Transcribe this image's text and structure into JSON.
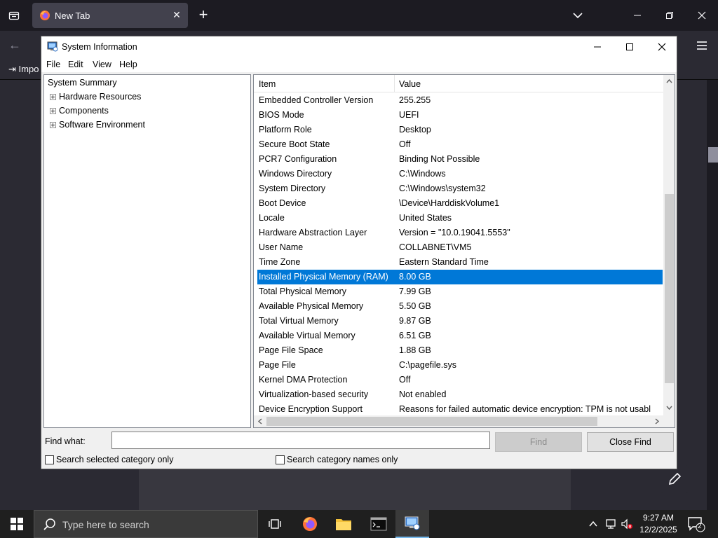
{
  "browser": {
    "tab_title": "New Tab",
    "import_label": "Impo"
  },
  "window": {
    "title": "System Information",
    "menu": [
      "File",
      "Edit",
      "View",
      "Help"
    ]
  },
  "tree": {
    "root": "System Summary",
    "children": [
      "Hardware Resources",
      "Components",
      "Software Environment"
    ]
  },
  "list": {
    "headers": {
      "item": "Item",
      "value": "Value"
    },
    "rows": [
      {
        "item": "Embedded Controller Version",
        "value": "255.255"
      },
      {
        "item": "BIOS Mode",
        "value": "UEFI"
      },
      {
        "item": "Platform Role",
        "value": "Desktop"
      },
      {
        "item": "Secure Boot State",
        "value": "Off"
      },
      {
        "item": "PCR7 Configuration",
        "value": "Binding Not Possible"
      },
      {
        "item": "Windows Directory",
        "value": "C:\\Windows"
      },
      {
        "item": "System Directory",
        "value": "C:\\Windows\\system32"
      },
      {
        "item": "Boot Device",
        "value": "\\Device\\HarddiskVolume1"
      },
      {
        "item": "Locale",
        "value": "United States"
      },
      {
        "item": "Hardware Abstraction Layer",
        "value": "Version = \"10.0.19041.5553\""
      },
      {
        "item": "User Name",
        "value": "COLLABNET\\VM5"
      },
      {
        "item": "Time Zone",
        "value": "Eastern Standard Time"
      },
      {
        "item": "Installed Physical Memory (RAM)",
        "value": "8.00 GB"
      },
      {
        "item": "Total Physical Memory",
        "value": "7.99 GB"
      },
      {
        "item": "Available Physical Memory",
        "value": "5.50 GB"
      },
      {
        "item": "Total Virtual Memory",
        "value": "9.87 GB"
      },
      {
        "item": "Available Virtual Memory",
        "value": "6.51 GB"
      },
      {
        "item": "Page File Space",
        "value": "1.88 GB"
      },
      {
        "item": "Page File",
        "value": "C:\\pagefile.sys"
      },
      {
        "item": "Kernel DMA Protection",
        "value": "Off"
      },
      {
        "item": "Virtualization-based security",
        "value": "Not enabled"
      },
      {
        "item": "Device Encryption Support",
        "value": "Reasons for failed automatic device encryption: TPM is not usabl"
      }
    ],
    "selected_row": "Installed Physical Memory (RAM)"
  },
  "find": {
    "label": "Find what:",
    "value": "",
    "find_button": "Find",
    "close_button": "Close Find",
    "search_selected": "Search selected category only",
    "search_names": "Search category names only"
  },
  "taskbar": {
    "search_placeholder": "Type here to search",
    "time": "9:27 AM",
    "date": "12/2/2025",
    "notification_count": "2"
  },
  "colors": {
    "selection": "#0078d7",
    "browser_bg": "#1c1b22",
    "taskbar_bg": "#1f1f1f"
  }
}
